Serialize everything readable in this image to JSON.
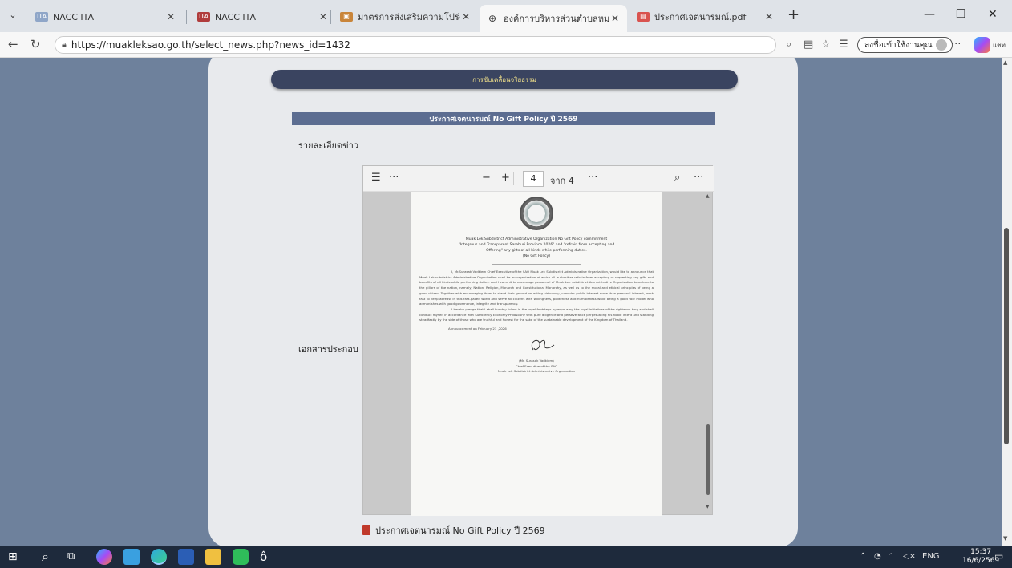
{
  "browser": {
    "tabs": [
      {
        "label": "NACC ITA",
        "active": false
      },
      {
        "label": "NACC ITA",
        "active": false
      },
      {
        "label": "มาตรการส่งเสริมความโปร่งใสและป้องกัน",
        "active": false
      },
      {
        "label": "องค์การบริหารส่วนตำบลหมากเหล็ก อำเภ",
        "active": true
      },
      {
        "label": "ประกาศเจตนารมณ์.pdf",
        "active": false
      }
    ],
    "url": "https://muakleksao.go.th/select_news.php?news_id=1432",
    "signin_label": "ลงชื่อเข้าใช้งานคุณ",
    "copilot_label": "แชท"
  },
  "page": {
    "section_pill": "การขับเคลื่อนจริยธรรม",
    "news_title": "ประกาศเจตนารมณ์ No Gift Policy ปี 2569",
    "detail_label": "รายละเอียดข่าว",
    "attachment_label": "เอกสารประกอบ",
    "file_link": "ประกาศเจตนารมณ์ No Gift Policy ปี 2569"
  },
  "pdf_viewer": {
    "current_page": "4",
    "of_label": "จาก 4",
    "doc": {
      "heading_1": "Muak Lek Subdistrict Administrative Organization No Gift Policy commitment",
      "heading_2": "\"Integrous and Transparent Saraburi Province 2026\" and \"refrain from accepting and",
      "heading_3": "Offering\" any gifts of all kinds while performing duties.",
      "heading_4": "(No Gift Policy)",
      "paragraph_1": "I, Mr.Surasak Vadkiem Chief Executive of the SAO Muak Lek Subdistrict Administrative Organization, would like to announce that Muak Lek subdistrict Administrative Organization shall be an organization of which all authorities refrain from accepting or requesting any gifts and benefits of all kinds while performing duties. And I commit to encourage personnel of Muak Lek subdistrict Administrative Organization to adhere to the pillars of the nation, namely, Nation, Religion, Monarch and Constitutional Monarchy, as well as to the moral and ethical principles of being a good citizen. Together with encouraging them to stand their ground on acting virtuously, consider public interest more than personal interest, work fast to keep abreast in this fast-paced world and serve all citizens with willingness, politeness and humbleness while being a good role model who admonishes with good governance, integrity and transparency.",
      "paragraph_2": "I hereby pledge that I shall humbly follow in the royal footsteps by espousing the royal initiatives of the righteous king and shall conduct myself in accordance with Sufficiency Economy Philosophy with pure diligence and perseverance perpetuating his noble intent and standing steadfastly by the side of those who are truthful and honest for the sake of the sustainable development of the Kingdom of Thailand.",
      "announcement": "Announcement on February 23 ,2026",
      "signer_name": "(Mr. Surasak Vadkiem)",
      "signer_title": "Chief Executive of the SAO",
      "signer_org": "Muak Lek Subdistrict Administrative Organization"
    }
  },
  "taskbar": {
    "lang": "ENG",
    "time": "15:37",
    "date": "16/6/2569"
  }
}
